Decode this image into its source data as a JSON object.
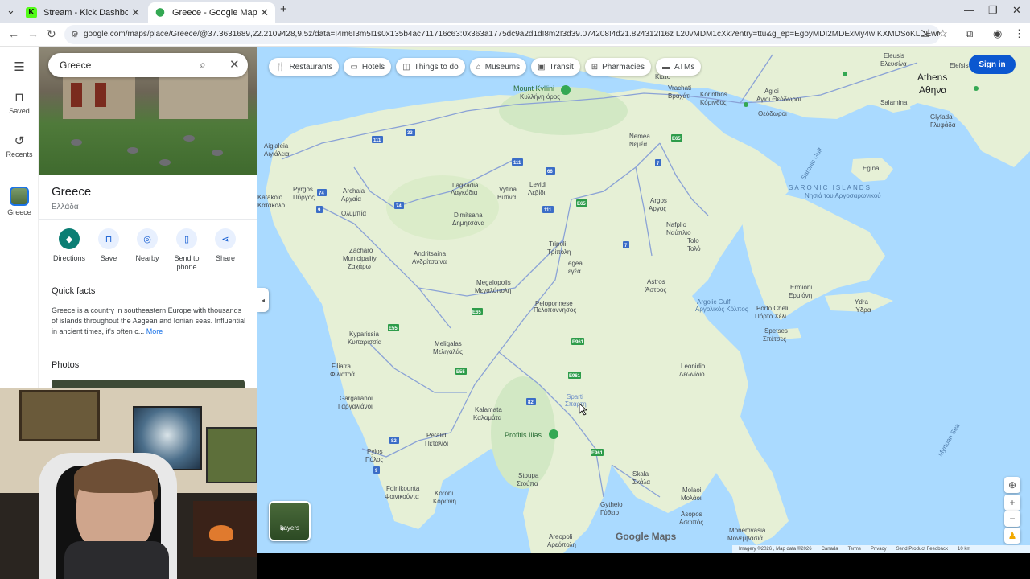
{
  "browser": {
    "tabs": [
      {
        "title": "Stream - Kick Dashboard",
        "active": false,
        "favicon": "kick-icon"
      },
      {
        "title": "Greece - Google Maps",
        "active": true,
        "favicon": "maps-pin-icon"
      }
    ],
    "url": "google.com/maps/place/Greece/@37.3631689,22.2109428,9.5z/data=!4m6!3m5!1s0x135b4ac711716c63:0x363a1775dc9a2d1d!8m2!3d39.074208!4d21.824312!16z L20vMDM1cXk?entry=ttu&g_ep=EgoyMDI2MDExMy4wIKXMDSoKLDEwMDc5MjA2N0..."
  },
  "rail": {
    "items": [
      {
        "label": "",
        "icon": "menu-icon"
      },
      {
        "label": "Saved",
        "icon": "bookmark-icon"
      },
      {
        "label": "Recents",
        "icon": "history-icon"
      },
      {
        "label": "Greece",
        "icon": "place-thumbnail"
      }
    ]
  },
  "search": {
    "value": "Greece"
  },
  "place": {
    "title": "Greece",
    "subtitle": "Ελλάδα",
    "actions": [
      {
        "label": "Directions",
        "icon": "directions-icon"
      },
      {
        "label": "Save",
        "icon": "bookmark-icon"
      },
      {
        "label": "Nearby",
        "icon": "nearby-icon"
      },
      {
        "label": "Send to phone",
        "icon": "phone-icon"
      },
      {
        "label": "Share",
        "icon": "share-icon"
      }
    ],
    "quick_facts_heading": "Quick facts",
    "quick_facts_text": "Greece is a country in southeastern Europe with thousands of islands throughout the Aegean and Ionian seas. Influential in ancient times, it's often c...",
    "more_label": "More",
    "photos_heading": "Photos"
  },
  "map": {
    "chips": [
      {
        "label": "Restaurants",
        "icon": "fork-knife-icon"
      },
      {
        "label": "Hotels",
        "icon": "bed-icon"
      },
      {
        "label": "Things to do",
        "icon": "camera-icon"
      },
      {
        "label": "Museums",
        "icon": "museum-icon"
      },
      {
        "label": "Transit",
        "icon": "train-icon"
      },
      {
        "label": "Pharmacies",
        "icon": "pharmacy-icon"
      },
      {
        "label": "ATMs",
        "icon": "atm-icon"
      }
    ],
    "sign_in": "Sign in",
    "layers_label": "Layers",
    "logo": "Google Maps",
    "footer": [
      "Imagery ©2026 , Map data ©2026",
      "Canada",
      "Terms",
      "Privacy",
      "Send Product Feedback",
      "10 km"
    ],
    "labels": {
      "athens": "Athens",
      "athens_gr": "Αθηνα",
      "mount_kyllini": "Mount Kyllini",
      "mount_kyllini_gr": "Κυλλήνη όρος",
      "profitis": "Profitis Ilias",
      "saronic": "SARONIC ISLANDS",
      "saronic_gr": "Νησιά του Αργοσαρωνικού",
      "argolic": "Argolic Gulf",
      "argolic_gr": "Αργολικός Κόλπος",
      "myrtoan": "Myrtoan Sea",
      "saronic_gulf": "Saronic Gulf",
      "peloponnese": "Peloponnese",
      "peloponnese_gr": "Πελοπόννησος",
      "sparti": "Sparti",
      "sparti_gr": "Σπάρτη",
      "eleusis": "Eleusis",
      "eleusis_gr": "Ελευσίνα",
      "salamina": "Salamina",
      "glyfada": "Glyfada",
      "glyfada_gr": "Γλυφάδα",
      "aegina": "Egina",
      "vrachati": "Vrachati",
      "vrachati_gr": "Βραχάτι",
      "korinthos": "Korinthos",
      "korinthos_gr": "Κόρινθος",
      "agioi": "Agioi",
      "agioi_gr": "Θεόδωροι",
      "agioi_gr2": "Αγιοι Θεόδωροι",
      "kiato": "Κιάτο",
      "nemea": "Nemea",
      "nemea_gr": "Νεμέα",
      "aigio": "Aigialeia",
      "aigio_gr": "Αιγιάλεια",
      "pyrgos": "Pyrgos",
      "pyrgos_gr": "Πύργος",
      "archaia": "Archaia",
      "archaia_gr": "Ολυμπία",
      "archaia_gr2": "Αρχαία",
      "lagkadia": "Lagkadia",
      "lagkadia_gr": "Λαγκάδια",
      "vytina": "Vytina",
      "vytina_gr": "Βυτίνα",
      "levidi": "Levidi",
      "levidi_gr": "Λεβίδι",
      "argos": "Argos",
      "argos_gr": "Άργος",
      "nafplio": "Nafplio",
      "nafplio_gr": "Ναύπλιο",
      "tolo": "Tolo",
      "tolo_gr": "Τολό",
      "katakolo": "Katakolo",
      "katakolo_gr": "Κατάκολο",
      "dimitsana": "Dimitsana",
      "dimitsana_gr": "Δημητσάνα",
      "zacharo": "Zacharo",
      "zacharo_gr": "Municipality",
      "zacharo_gr2": "Ζαχάρω",
      "andritsaina": "Andritsaina",
      "andritsaina_gr": "Ανδρίτσαινα",
      "tripoli": "Tripoli",
      "tripoli_gr": "Τρίπολη",
      "tegea": "Tegea",
      "tegea_gr": "Τεγέα",
      "megalopolis": "Megalopolis",
      "megalopolis_gr": "Μεγαλόπολη",
      "astros": "Astros",
      "astros_gr": "Άστρος",
      "ermioni": "Ermioni",
      "ermioni_gr": "Ερμιόνη",
      "ydra": "Ydra",
      "ydra_gr": "Ύδρα",
      "portocheli": "Porto Cheli",
      "portocheli_gr": "Πόρτο Χέλι",
      "spetses": "Spetses",
      "spetses_gr": "Σπέτσες",
      "kyparissia": "Kyparissia",
      "kyparissia_gr": "Κυπαρισσία",
      "meligalas": "Meligalas",
      "meligalas_gr": "Μελιγαλάς",
      "filiatra": "Filiatra",
      "filiatra_gr": "Φιλιατρά",
      "leonidio": "Leonidio",
      "leonidio_gr": "Λεωνίδιο",
      "gargalianoi": "Gargalianoi",
      "gargalianoi_gr": "Γαργαλιάνοι",
      "kalamata": "Kalamata",
      "kalamata_gr": "Καλαμάτα",
      "petalidi": "Petalidi",
      "petalidi_gr": "Πεταλίδι",
      "pylos": "Pylos",
      "pylos_gr": "Πύλος",
      "stoupa": "Stoupa",
      "stoupa_gr": "Στούπα",
      "skala": "Skala",
      "skala_gr": "Σκάλα",
      "molaoi": "Molaoi",
      "molaoi_gr": "Μολάοι",
      "gytheio": "Gytheio",
      "gytheio_gr": "Γύθειο",
      "asopos": "Asopos",
      "asopos_gr": "Ασωπός",
      "foinikounta": "Foinikounta",
      "foinikounta_gr": "Φοινικούντα",
      "koroni": "Koroni",
      "koroni_gr": "Κορώνη",
      "areopoli": "Areopoli",
      "areopoli_gr": "Αρεόπολη",
      "monemvasia": "Monemvasia",
      "monemvasia_gr": "Μονεμβασιά",
      "elefsis": "Elefsis"
    },
    "shields": [
      "33",
      "111",
      "111",
      "74",
      "74",
      "9",
      "111",
      "66",
      "7",
      "E65",
      "E65",
      "7",
      "E65",
      "E55",
      "E55",
      "E961",
      "E961",
      "82",
      "82",
      "9",
      "E961"
    ]
  },
  "colors": {
    "accent": "#0b57d0",
    "directions": "#0b7e74",
    "water": "#aadaff",
    "land": "#e6f0d6",
    "park": "#c8e6b8"
  }
}
